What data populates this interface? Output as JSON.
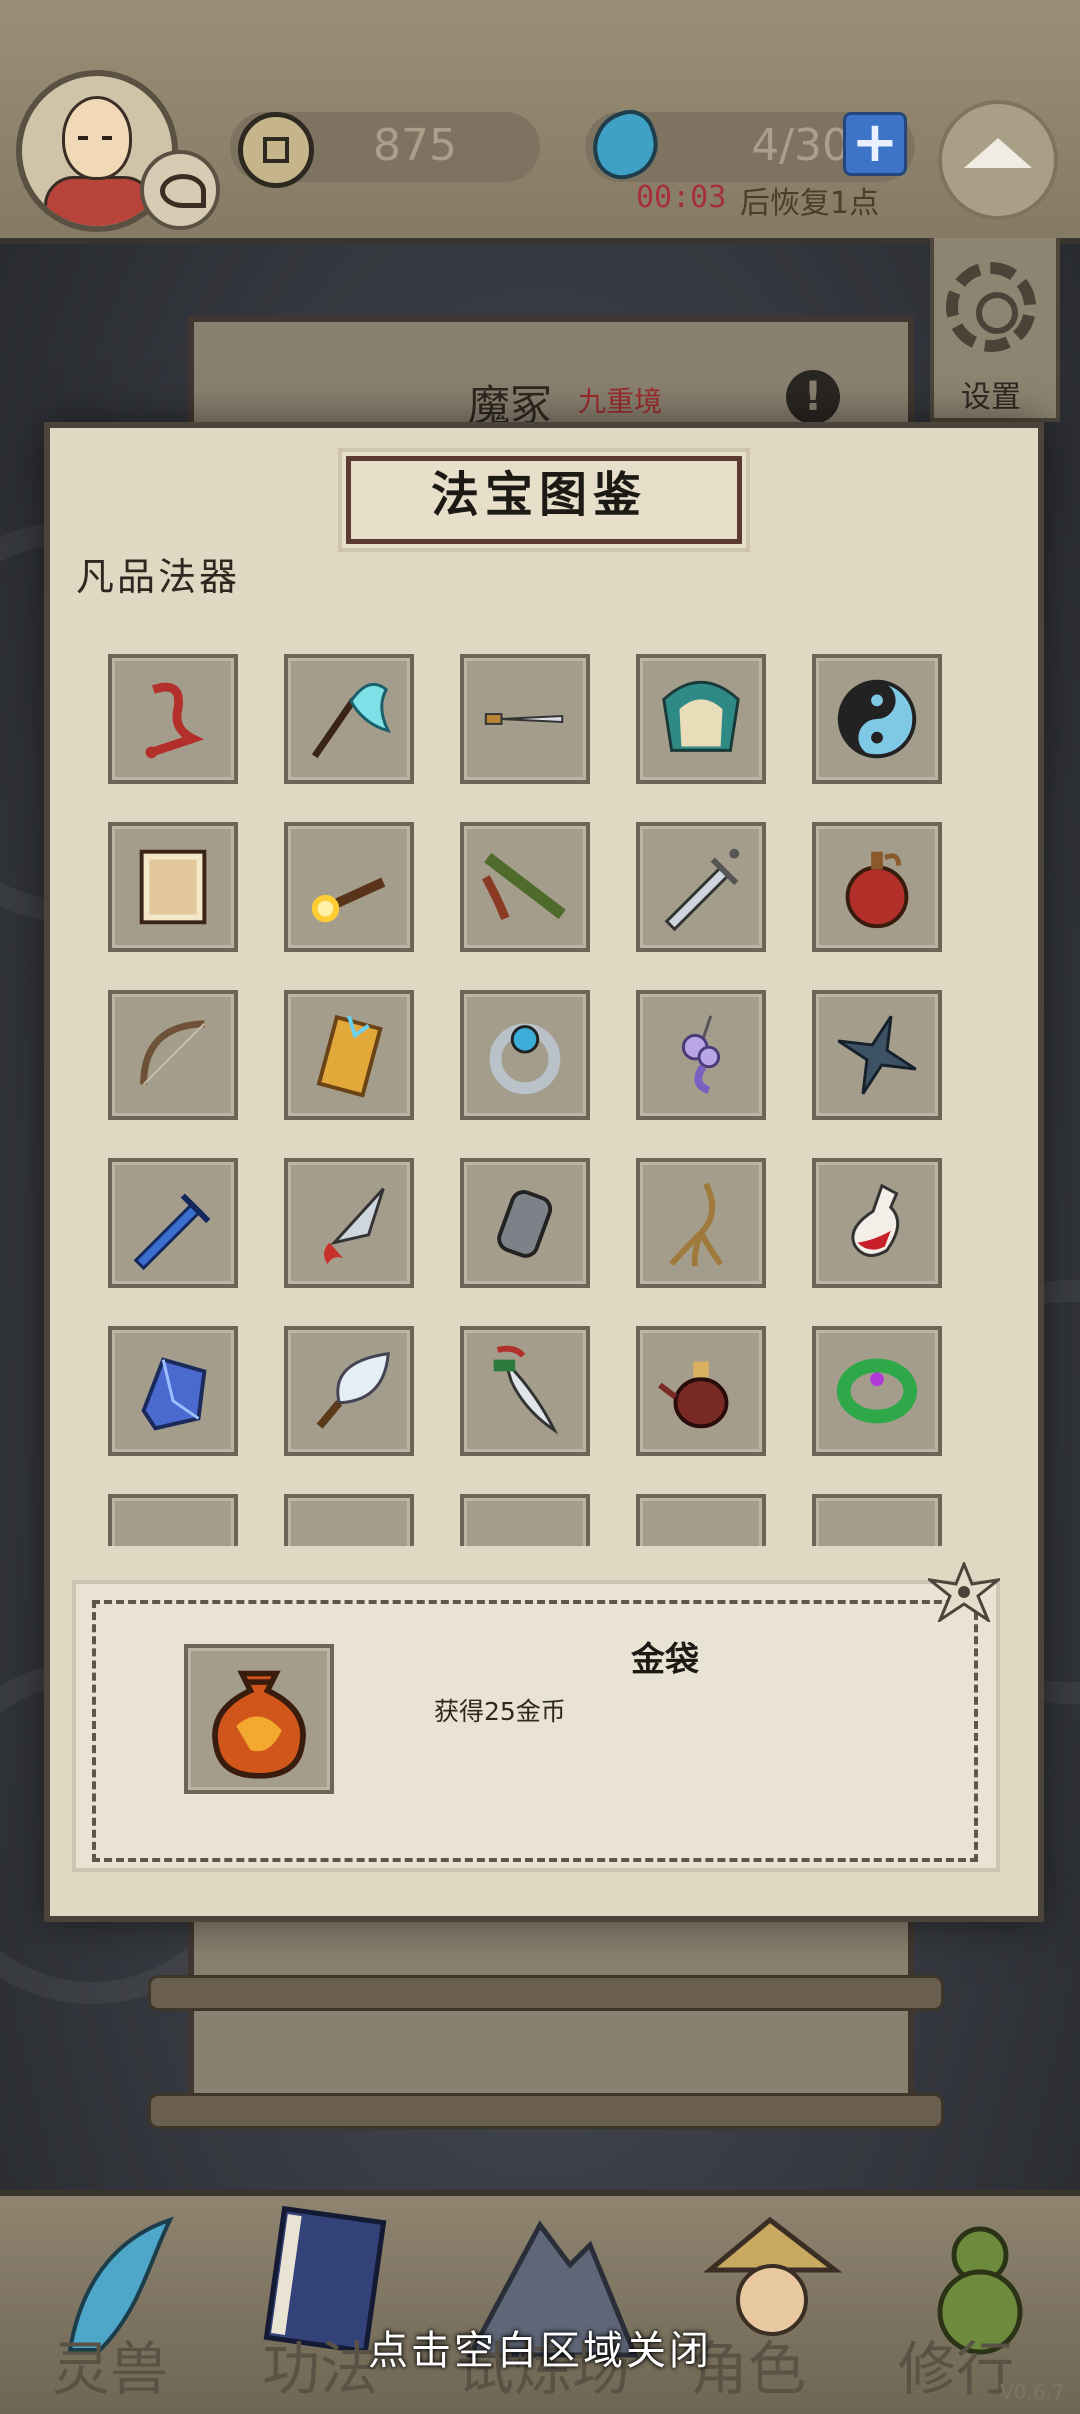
{
  "topbar": {
    "coins": "875",
    "stamina": "4/30",
    "recover_time": "00:03",
    "recover_text": "后恢复1点"
  },
  "scene": {
    "realm_name": "魔冢",
    "realm_level": "九重境",
    "settings_label": "设置"
  },
  "codex": {
    "title": "法宝图鉴",
    "category": "凡品法器",
    "items": [
      {
        "icon": "red-rope-icon"
      },
      {
        "icon": "cyan-feather-whisk-icon"
      },
      {
        "icon": "dagger-icon"
      },
      {
        "icon": "folding-fan-icon"
      },
      {
        "icon": "yin-yang-icon"
      },
      {
        "icon": "scroll-paper-icon"
      },
      {
        "icon": "fire-torch-icon"
      },
      {
        "icon": "bamboo-flute-icon"
      },
      {
        "icon": "steel-sword-icon"
      },
      {
        "icon": "red-gourd-icon"
      },
      {
        "icon": "bow-icon"
      },
      {
        "icon": "talisman-icon"
      },
      {
        "icon": "blue-gem-ring-icon"
      },
      {
        "icon": "cloud-pendant-icon"
      },
      {
        "icon": "shuriken-icon"
      },
      {
        "icon": "blue-sword-icon"
      },
      {
        "icon": "red-tassel-knife-icon"
      },
      {
        "icon": "gauntlet-icon"
      },
      {
        "icon": "ginseng-icon"
      },
      {
        "icon": "potion-bottle-icon"
      },
      {
        "icon": "blue-crystal-icon"
      },
      {
        "icon": "feather-fan-icon"
      },
      {
        "icon": "curved-blade-icon"
      },
      {
        "icon": "wine-pot-icon"
      },
      {
        "icon": "jade-bracelet-icon"
      },
      {
        "icon": "brown-pot-icon"
      },
      {
        "icon": "vase-icon"
      },
      {
        "icon": "blue-item-icon"
      },
      {
        "icon": "orange-horn-icon"
      },
      {
        "icon": "money-bag-icon"
      }
    ]
  },
  "detail": {
    "name": "金袋",
    "description": "获得25金币",
    "icon": "gold-money-bag-icon"
  },
  "nav": {
    "items": [
      {
        "label": "灵兽",
        "icon": "feather-icon"
      },
      {
        "label": "功法",
        "icon": "book-icon"
      },
      {
        "label": "试炼场",
        "icon": "mountain-icon"
      },
      {
        "label": "角色",
        "icon": "character-icon"
      },
      {
        "label": "修行",
        "icon": "gourd-icon"
      }
    ]
  },
  "close_hint": "点击空白区域关闭",
  "version": "V0.6.7"
}
